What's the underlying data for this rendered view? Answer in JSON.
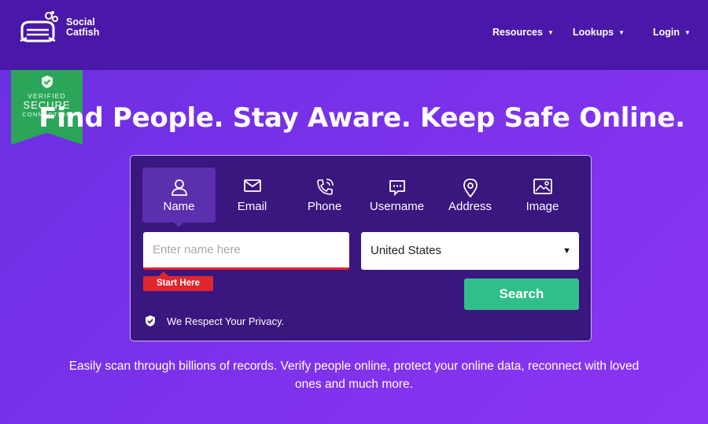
{
  "brand": {
    "name_line1": "Social",
    "name_line2": "Catfish"
  },
  "nav": {
    "resources": "Resources",
    "lookups": "Lookups",
    "login": "Login"
  },
  "badge": {
    "line1": "VERIFIED",
    "line2": "SECURE",
    "line3": "CONNECTION"
  },
  "hero": {
    "title": "Find People. Stay Aware. Keep Safe Online."
  },
  "search": {
    "tabs": [
      {
        "label": "Name",
        "icon": "person-icon",
        "active": true
      },
      {
        "label": "Email",
        "icon": "envelope-icon"
      },
      {
        "label": "Phone",
        "icon": "phone-icon"
      },
      {
        "label": "Username",
        "icon": "chat-bubble-icon"
      },
      {
        "label": "Address",
        "icon": "map-pin-icon"
      },
      {
        "label": "Image",
        "icon": "image-icon"
      }
    ],
    "name_placeholder": "Enter name here",
    "start_here": "Start Here",
    "country_selected": "United States",
    "search_button": "Search",
    "privacy": "We Respect Your Privacy."
  },
  "subtext": "Easily scan through billions of records. Verify people online, protect your online data, reconnect with loved ones and much more.",
  "colors": {
    "header": "#4a18a8",
    "card": "#3a167f",
    "accent_green": "#2fc08a",
    "alert_red": "#e0262c",
    "badge_green": "#2ba55a"
  }
}
